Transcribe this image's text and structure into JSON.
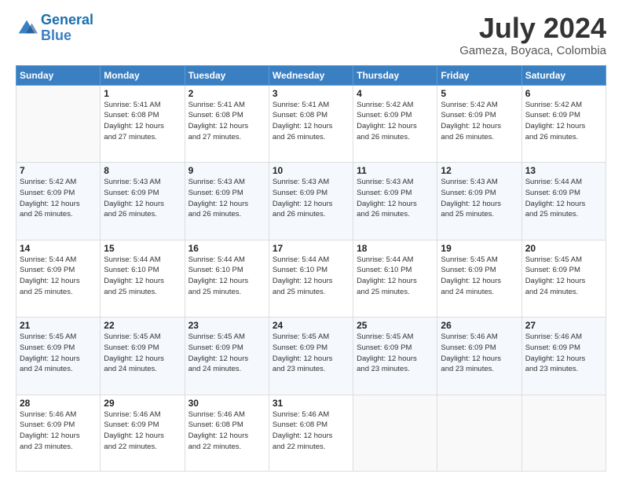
{
  "header": {
    "logo_line1": "General",
    "logo_line2": "Blue",
    "title": "July 2024",
    "subtitle": "Gameza, Boyaca, Colombia"
  },
  "weekdays": [
    "Sunday",
    "Monday",
    "Tuesday",
    "Wednesday",
    "Thursday",
    "Friday",
    "Saturday"
  ],
  "weeks": [
    [
      {
        "day": "",
        "info": ""
      },
      {
        "day": "1",
        "info": "Sunrise: 5:41 AM\nSunset: 6:08 PM\nDaylight: 12 hours\nand 27 minutes."
      },
      {
        "day": "2",
        "info": "Sunrise: 5:41 AM\nSunset: 6:08 PM\nDaylight: 12 hours\nand 27 minutes."
      },
      {
        "day": "3",
        "info": "Sunrise: 5:41 AM\nSunset: 6:08 PM\nDaylight: 12 hours\nand 26 minutes."
      },
      {
        "day": "4",
        "info": "Sunrise: 5:42 AM\nSunset: 6:09 PM\nDaylight: 12 hours\nand 26 minutes."
      },
      {
        "day": "5",
        "info": "Sunrise: 5:42 AM\nSunset: 6:09 PM\nDaylight: 12 hours\nand 26 minutes."
      },
      {
        "day": "6",
        "info": "Sunrise: 5:42 AM\nSunset: 6:09 PM\nDaylight: 12 hours\nand 26 minutes."
      }
    ],
    [
      {
        "day": "7",
        "info": "Sunrise: 5:42 AM\nSunset: 6:09 PM\nDaylight: 12 hours\nand 26 minutes."
      },
      {
        "day": "8",
        "info": "Sunrise: 5:43 AM\nSunset: 6:09 PM\nDaylight: 12 hours\nand 26 minutes."
      },
      {
        "day": "9",
        "info": "Sunrise: 5:43 AM\nSunset: 6:09 PM\nDaylight: 12 hours\nand 26 minutes."
      },
      {
        "day": "10",
        "info": "Sunrise: 5:43 AM\nSunset: 6:09 PM\nDaylight: 12 hours\nand 26 minutes."
      },
      {
        "day": "11",
        "info": "Sunrise: 5:43 AM\nSunset: 6:09 PM\nDaylight: 12 hours\nand 26 minutes."
      },
      {
        "day": "12",
        "info": "Sunrise: 5:43 AM\nSunset: 6:09 PM\nDaylight: 12 hours\nand 25 minutes."
      },
      {
        "day": "13",
        "info": "Sunrise: 5:44 AM\nSunset: 6:09 PM\nDaylight: 12 hours\nand 25 minutes."
      }
    ],
    [
      {
        "day": "14",
        "info": "Sunrise: 5:44 AM\nSunset: 6:09 PM\nDaylight: 12 hours\nand 25 minutes."
      },
      {
        "day": "15",
        "info": "Sunrise: 5:44 AM\nSunset: 6:10 PM\nDaylight: 12 hours\nand 25 minutes."
      },
      {
        "day": "16",
        "info": "Sunrise: 5:44 AM\nSunset: 6:10 PM\nDaylight: 12 hours\nand 25 minutes."
      },
      {
        "day": "17",
        "info": "Sunrise: 5:44 AM\nSunset: 6:10 PM\nDaylight: 12 hours\nand 25 minutes."
      },
      {
        "day": "18",
        "info": "Sunrise: 5:44 AM\nSunset: 6:10 PM\nDaylight: 12 hours\nand 25 minutes."
      },
      {
        "day": "19",
        "info": "Sunrise: 5:45 AM\nSunset: 6:09 PM\nDaylight: 12 hours\nand 24 minutes."
      },
      {
        "day": "20",
        "info": "Sunrise: 5:45 AM\nSunset: 6:09 PM\nDaylight: 12 hours\nand 24 minutes."
      }
    ],
    [
      {
        "day": "21",
        "info": "Sunrise: 5:45 AM\nSunset: 6:09 PM\nDaylight: 12 hours\nand 24 minutes."
      },
      {
        "day": "22",
        "info": "Sunrise: 5:45 AM\nSunset: 6:09 PM\nDaylight: 12 hours\nand 24 minutes."
      },
      {
        "day": "23",
        "info": "Sunrise: 5:45 AM\nSunset: 6:09 PM\nDaylight: 12 hours\nand 24 minutes."
      },
      {
        "day": "24",
        "info": "Sunrise: 5:45 AM\nSunset: 6:09 PM\nDaylight: 12 hours\nand 23 minutes."
      },
      {
        "day": "25",
        "info": "Sunrise: 5:45 AM\nSunset: 6:09 PM\nDaylight: 12 hours\nand 23 minutes."
      },
      {
        "day": "26",
        "info": "Sunrise: 5:46 AM\nSunset: 6:09 PM\nDaylight: 12 hours\nand 23 minutes."
      },
      {
        "day": "27",
        "info": "Sunrise: 5:46 AM\nSunset: 6:09 PM\nDaylight: 12 hours\nand 23 minutes."
      }
    ],
    [
      {
        "day": "28",
        "info": "Sunrise: 5:46 AM\nSunset: 6:09 PM\nDaylight: 12 hours\nand 23 minutes."
      },
      {
        "day": "29",
        "info": "Sunrise: 5:46 AM\nSunset: 6:09 PM\nDaylight: 12 hours\nand 22 minutes."
      },
      {
        "day": "30",
        "info": "Sunrise: 5:46 AM\nSunset: 6:08 PM\nDaylight: 12 hours\nand 22 minutes."
      },
      {
        "day": "31",
        "info": "Sunrise: 5:46 AM\nSunset: 6:08 PM\nDaylight: 12 hours\nand 22 minutes."
      },
      {
        "day": "",
        "info": ""
      },
      {
        "day": "",
        "info": ""
      },
      {
        "day": "",
        "info": ""
      }
    ]
  ]
}
